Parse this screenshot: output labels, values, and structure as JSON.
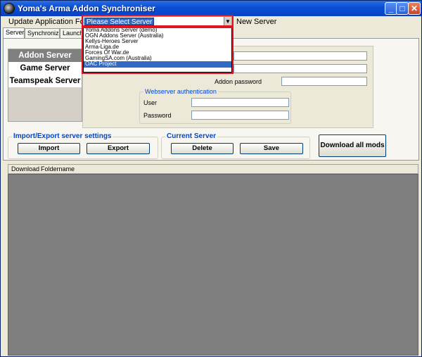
{
  "window": {
    "title": "Yoma's Arma Addon Synchroniser"
  },
  "titlebar_buttons": {
    "minimize": "_",
    "maximize": "□",
    "close": "✕"
  },
  "menu": {
    "update": "Update",
    "application_folder": "Application Folder",
    "new_server": "New Server"
  },
  "server_select": {
    "selected": "Please Select Server",
    "options": [
      "Yoma Addons Server (demo)",
      "OGN Addons Server (Australia)",
      "Kellys-Heroes Server",
      "Arma-Liga.de",
      "Forces Of War.de",
      "GamingSA.com (Australia)",
      "OAC Project"
    ],
    "highlighted_option": "OAC Project"
  },
  "tabs": [
    "Server",
    "Synchronize",
    "Launch G"
  ],
  "nav": [
    "Addon Server",
    "Game Server",
    "Teamspeak Server"
  ],
  "settings": {
    "addon_password_label": "Addon password",
    "webserver_group_title": "Webserver authentication",
    "user_label": "User",
    "password_label": "Password"
  },
  "import_export": {
    "title": "Import/Export server settings",
    "import": "Import",
    "export": "Export"
  },
  "current_server": {
    "title": "Current Server",
    "delete": "Delete",
    "save": "Save"
  },
  "download_all": "Download all mods",
  "table": {
    "columns": [
      "Download",
      "Foldername"
    ]
  },
  "colors": {
    "highlight": "#e0151f",
    "selection": "#316ac5",
    "titlebar": "#0a4fd6",
    "table_bg": "#7f7f7f"
  }
}
